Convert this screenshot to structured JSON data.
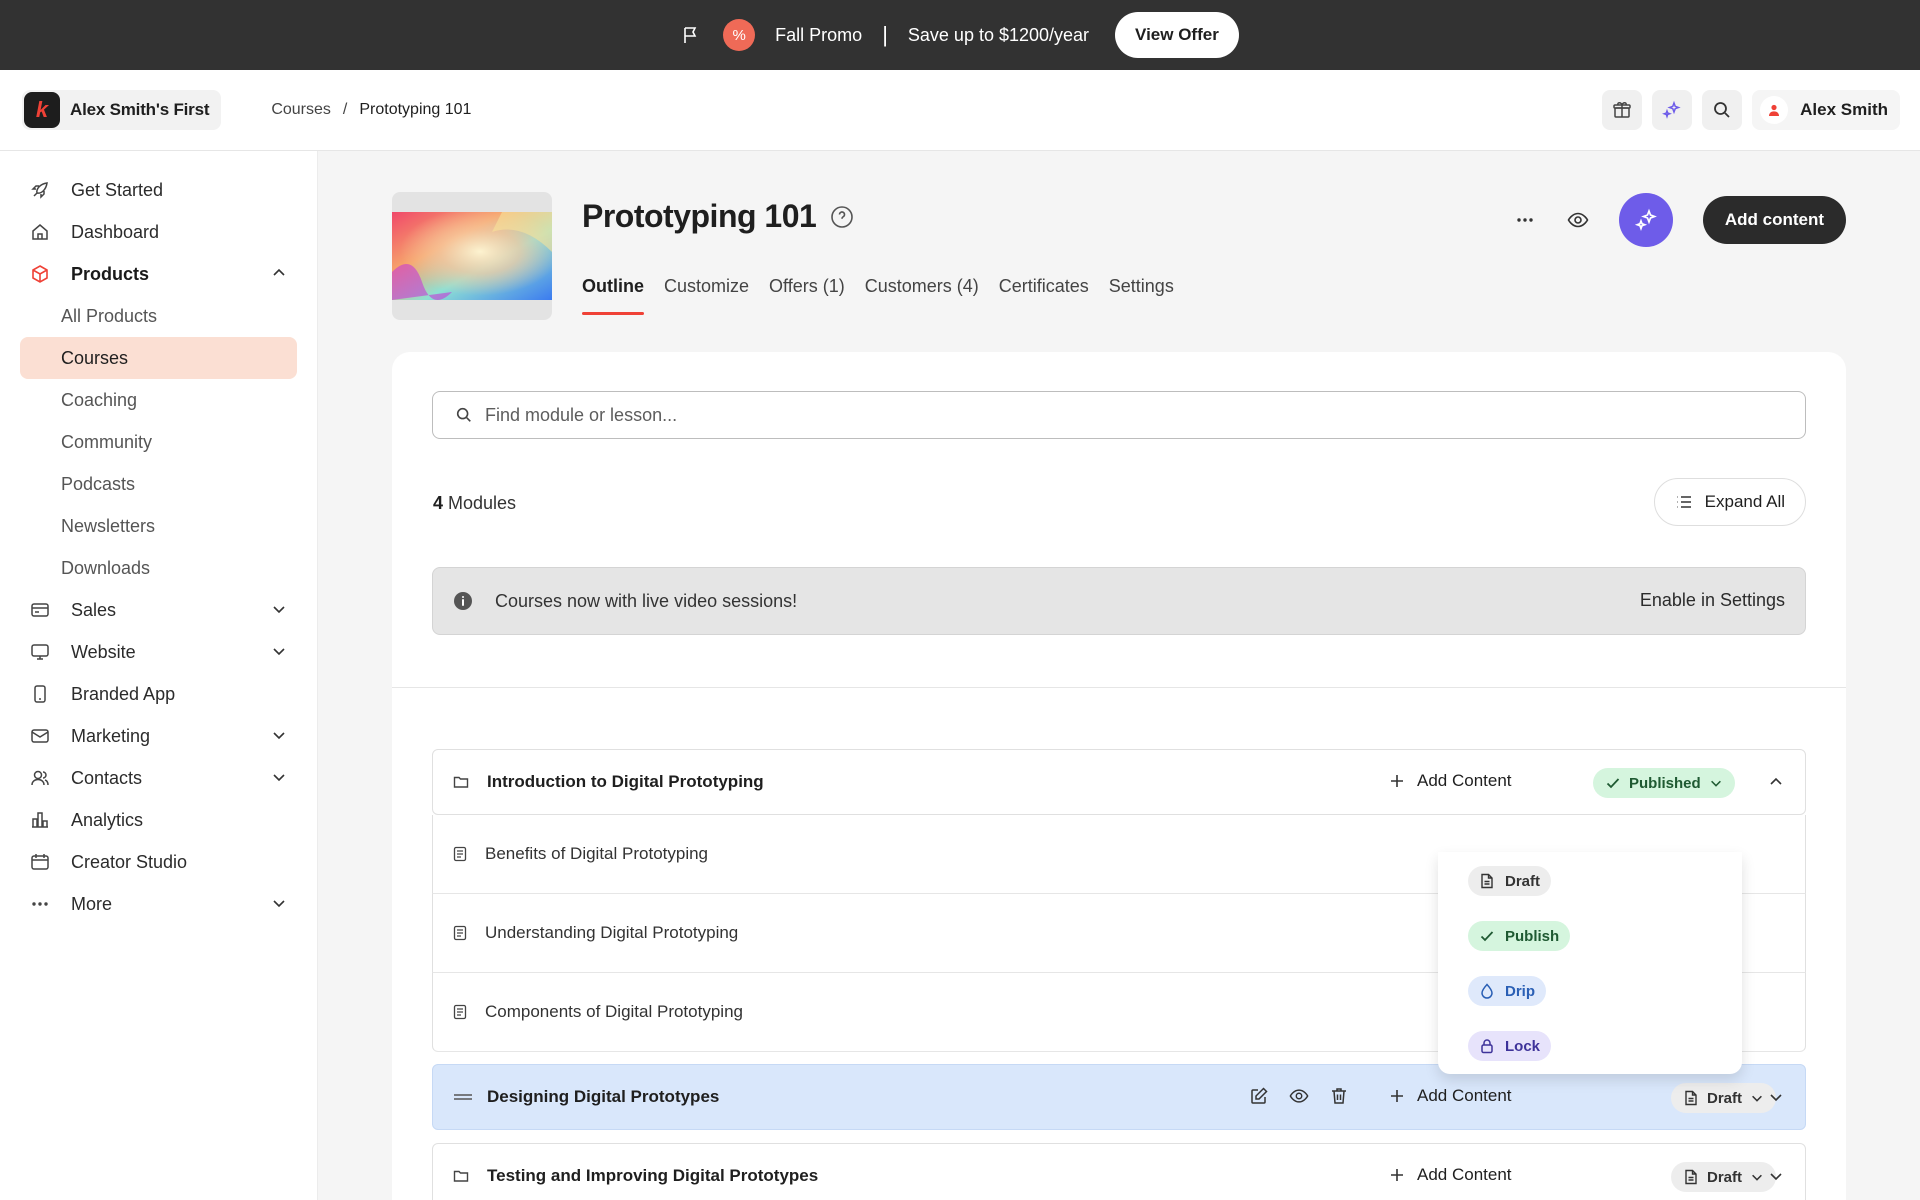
{
  "promo": {
    "title": "Fall Promo",
    "separator": "|",
    "message": "Save up to $1200/year",
    "button": "View Offer"
  },
  "header": {
    "brand_name": "Alex Smith's First",
    "breadcrumb": [
      "Courses",
      "/",
      "Prototyping 101"
    ],
    "user_name": "Alex Smith"
  },
  "sidebar": {
    "items": [
      {
        "label": "Get Started",
        "icon": "rocket-icon"
      },
      {
        "label": "Dashboard",
        "icon": "home-icon"
      },
      {
        "label": "Products",
        "icon": "box-icon"
      },
      {
        "label": "Sales",
        "icon": "card-icon"
      },
      {
        "label": "Website",
        "icon": "monitor-icon"
      },
      {
        "label": "Branded App",
        "icon": "phone-icon"
      },
      {
        "label": "Marketing",
        "icon": "mail-icon"
      },
      {
        "label": "Contacts",
        "icon": "contacts-icon"
      },
      {
        "label": "Analytics",
        "icon": "bar-chart-icon"
      },
      {
        "label": "Creator Studio",
        "icon": "calendar-icon"
      },
      {
        "label": "More",
        "icon": "more-icon"
      }
    ],
    "products_sub": [
      "All Products",
      "Courses",
      "Coaching",
      "Community",
      "Podcasts",
      "Newsletters",
      "Downloads"
    ]
  },
  "product": {
    "title": "Prototyping 101",
    "tabs": [
      "Outline",
      "Customize",
      "Offers (1)",
      "Customers (4)",
      "Certificates",
      "Settings"
    ],
    "add_content_button": "Add content"
  },
  "outline": {
    "search_placeholder": "Find module or lesson...",
    "module_count": "4",
    "module_count_label": " Modules",
    "expand_all": "Expand All",
    "notice_text": "Courses now with live video sessions!",
    "notice_link": "Enable in Settings",
    "add_content": "Add Content",
    "modules": [
      {
        "name": "Introduction to Digital Prototyping",
        "status": "Published"
      },
      {
        "name": "Designing Digital Prototypes",
        "status": "Draft"
      },
      {
        "name": "Testing and Improving Digital Prototypes",
        "status": "Draft"
      }
    ],
    "lessons": [
      "Benefits of Digital Prototyping",
      "Understanding Digital Prototyping",
      "Components of Digital Prototyping"
    ],
    "status_menu": [
      "Draft",
      "Publish",
      "Drip",
      "Lock"
    ]
  },
  "colors": {
    "accent": "#ef4136",
    "ai_purple": "#6e5ce9",
    "selected_bg": "#fbdfd3",
    "highlight_row": "#d9e7fb"
  }
}
